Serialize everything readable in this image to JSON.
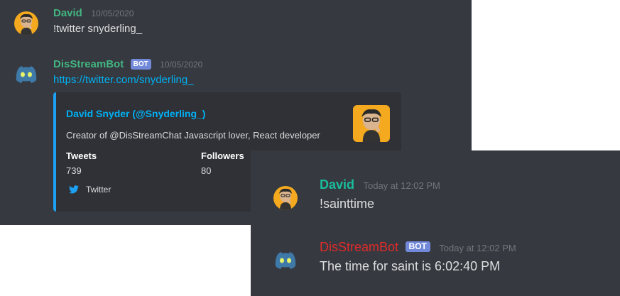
{
  "colors": {
    "background": "#36393f",
    "embed_background": "#2f3136",
    "embed_accent": "#1da1f2",
    "user_green": "#43b581",
    "bot_green": "#43b581",
    "user_teal": "#1abc9c",
    "bot_red": "#e02b2b",
    "link": "#00b0f4",
    "bot_badge": "#7289da"
  },
  "panel1": {
    "messages": [
      {
        "author": "David",
        "timestamp": "10/05/2020",
        "avatar": "user-avatar",
        "text": "!twitter snyderling_"
      },
      {
        "author": "DisStreamBot",
        "badge": "BOT",
        "timestamp": "10/05/2020",
        "avatar": "bot-avatar",
        "link": "https://twitter.com/snyderling_"
      }
    ],
    "embed": {
      "author": "David Snyder (@Snyderling_)",
      "description": "Creator of @DisStreamChat Javascript lover, React developer",
      "fields": [
        {
          "name": "Tweets",
          "value": "739"
        },
        {
          "name": "Followers",
          "value": "80"
        }
      ],
      "footer": "Twitter",
      "footer_icon": "twitter-bird-icon"
    }
  },
  "panel2": {
    "messages": [
      {
        "author": "David",
        "timestamp": "Today at 12:02 PM",
        "avatar": "user-avatar",
        "text": "!sainttime"
      },
      {
        "author": "DisStreamBot",
        "badge": "BOT",
        "timestamp": "Today at 12:02 PM",
        "avatar": "bot-avatar",
        "text": "The time for saint is 6:02:40 PM"
      }
    ]
  }
}
